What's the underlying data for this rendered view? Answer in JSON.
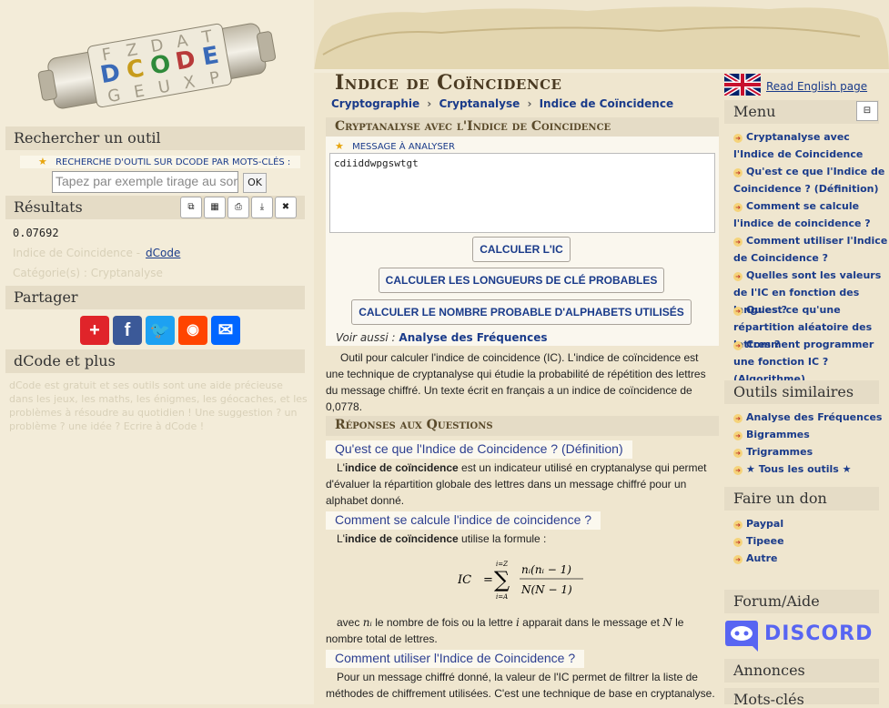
{
  "logo": {
    "letters": "DCODE"
  },
  "search": {
    "heading": "Rechercher un outil",
    "label": "Recherche d'outil sur dCode par mots-clés :",
    "placeholder": "Tapez par exemple tirage au sort",
    "button": "OK"
  },
  "results": {
    "heading": "Résultats",
    "value": "0.07692",
    "source_prefix": "Indice de Coincidence -",
    "source_link": "dCode",
    "category": "Catégorie(s) : Cryptanalyse"
  },
  "share": {
    "heading": "Partager"
  },
  "dcode_plus": {
    "heading": "dCode et plus",
    "text": "dCode est gratuit et ses outils sont une aide précieuse dans les jeux, les maths, les énigmes, les géocaches, et les problèmes à résoudre au quotidien ! Une suggestion ? un problème ? une idée ? Ecrire à dCode !"
  },
  "page": {
    "title": "Indice de Coïncidence",
    "breadcrumb": [
      "Cryptographie",
      "Cryptanalyse",
      "Indice de Coïncidence"
    ]
  },
  "tool": {
    "heading": "Cryptanalyse avec l'Indice de Coincidence",
    "message_label": "Message à analyser",
    "message_value": "cdiiddwpgswtgt",
    "btn_ic": "Calculer l'IC",
    "btn_lengths": "Calculer les longueurs de clé probables",
    "btn_alphabets": "Calculer le nombre probable d'alphabets utilisés",
    "see_also_label": "Voir aussi :",
    "see_also_link": "Analyse des Fréquences"
  },
  "intro": "Outil pour calculer l'indice de coincidence (IC). L'indice de coïncidence est une technique de cryptanalyse qui étudie la probabilité de répétition des lettres du message chiffré. Un texte écrit en français a un indice de coïncidence de 0,0778.",
  "answers": {
    "heading": "Réponses aux Questions",
    "q1": "Qu'est ce que l'Indice de Coincidence ? (Définition)",
    "a1_pre": "L'",
    "a1_bold": "indice de coïncidence",
    "a1_post": " est un indicateur utilisé en cryptanalyse qui permet d'évaluer la répartition globale des lettres dans un message chiffré pour un alphabet donné.",
    "q2": "Comment se calcule l'indice de coincidence ?",
    "a2_pre": "L'",
    "a2_bold": "indice de coïncidence",
    "a2_post": " utilise la formule :",
    "a2_avec": "avec",
    "a2_mid": "le nombre de fois ou la lettre",
    "a2_mid2": "apparait dans le message et",
    "a2_end": "le nombre total de lettres.",
    "q3": "Comment utiliser l'Indice de Coincidence ?",
    "a3": "Pour un message chiffré donné, la valeur de l'IC permet de filtrer la liste de méthodes de chiffrement utilisées. C'est une technique de base en cryptanalyse."
  },
  "lang": {
    "link": "Read English page"
  },
  "menu": {
    "heading": "Menu",
    "collapse": "⊟",
    "items": [
      "Cryptanalyse avec l'Indice de Coincidence",
      "Qu'est ce que l'Indice de Coincidence ? (Définition)",
      "Comment se calcule l'indice de coincidence ?",
      "Comment utiliser l'Indice de Coincidence ?",
      "Quelles sont les valeurs de l'IC en fonction des langues ?",
      "Qu'est ce qu'une répartition aléatoire des lettres ?",
      "Comment programmer une fonction IC ? (Algorithme)"
    ]
  },
  "similar": {
    "heading": "Outils similaires",
    "items": [
      "Analyse des Fréquences",
      "Bigrammes",
      "Trigrammes",
      "★ Tous les outils ★"
    ]
  },
  "donate": {
    "heading": "Faire un don",
    "items": [
      "Paypal",
      "Tipeee",
      "Autre"
    ]
  },
  "forum": {
    "heading": "Forum/Aide",
    "discord": "DISCORD"
  },
  "annonces": {
    "heading": "Annonces"
  },
  "keywords": {
    "heading": "Mots-clés"
  },
  "colors": {
    "link": "#1a3b8a",
    "panel": "#e5dcc6",
    "background": "#efe6cf"
  }
}
